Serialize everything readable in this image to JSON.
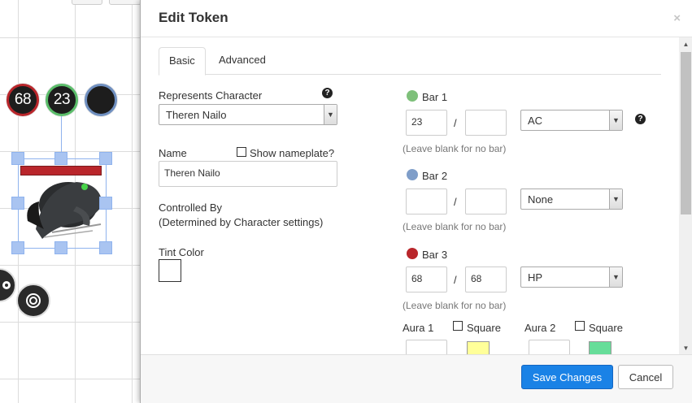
{
  "board": {
    "bubbles": [
      {
        "value": "68",
        "color": "#b9262b"
      },
      {
        "value": "23",
        "color": "#5bbd6a"
      },
      {
        "value": "",
        "color": "#6f8fc0"
      }
    ]
  },
  "dialog": {
    "title": "Edit Token",
    "close": "×",
    "tabs": [
      {
        "label": "Basic",
        "active": true
      },
      {
        "label": "Advanced",
        "active": false
      }
    ],
    "represents_label": "Represents Character",
    "represents_value": "Theren Nailo",
    "name_label": "Name",
    "show_nameplate_label": "Show nameplate?",
    "name_value": "Theren Nailo",
    "controlled_by_label": "Controlled By",
    "controlled_by_note": "(Determined by Character settings)",
    "tint_label": "Tint Color",
    "help_glyph": "?",
    "bars": [
      {
        "label": "Bar 1",
        "color": "#7ec07a",
        "value": "23",
        "max": "",
        "link": "AC",
        "hint": "(Leave blank for no bar)"
      },
      {
        "label": "Bar 2",
        "color": "#7f9ec9",
        "value": "",
        "max": "",
        "link": "None",
        "hint": "(Leave blank for no bar)"
      },
      {
        "label": "Bar 3",
        "color": "#b9262b",
        "value": "68",
        "max": "68",
        "link": "HP",
        "hint": "(Leave blank for no bar)"
      }
    ],
    "slash": "/",
    "aura1_label": "Aura 1",
    "aura2_label": "Aura 2",
    "square_label": "Square",
    "aura1_color": "#ffff99",
    "aura2_color": "#66dd99",
    "save_label": "Save Changes",
    "cancel_label": "Cancel"
  }
}
